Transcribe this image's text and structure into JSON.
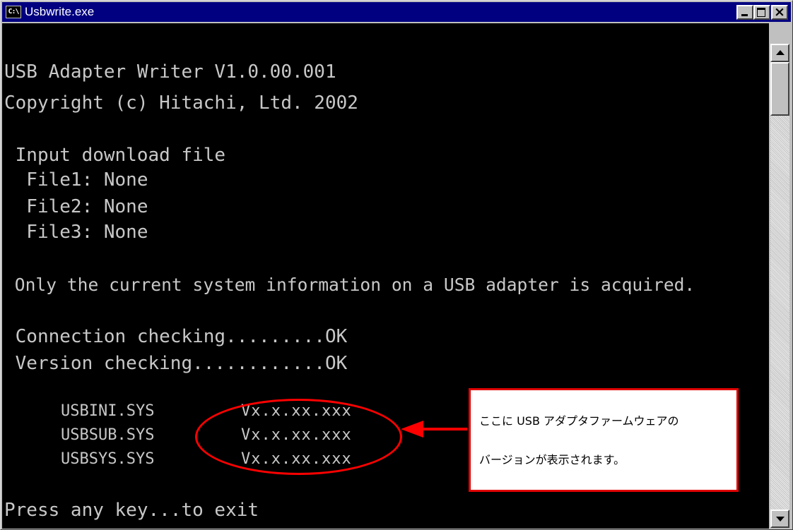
{
  "window": {
    "title": "Usbwrite.exe",
    "icon_name": "console-app-icon",
    "icon_text": "C:\\",
    "controls": {
      "minimize": "minimize-icon",
      "maximize": "maximize-icon",
      "close": "×"
    }
  },
  "console": {
    "lines": [
      "USB Adapter Writer V1.0.00.001",
      "Copyright (c) Hitachi, Ltd. 2002",
      " Input download file",
      "  File1: None",
      "  File2: None",
      "  File3: None",
      " Only the current system information on a USB adapter is acquired.",
      " Connection checking.........OK",
      " Version checking............OK",
      "Press any key...to exit"
    ],
    "versions": [
      {
        "file": "USBINI.SYS",
        "version": "Vx.x.xx.xxx"
      },
      {
        "file": "USBSUB.SYS",
        "version": "Vx.x.xx.xxx"
      },
      {
        "file": "USBSYS.SYS",
        "version": "Vx.x.xx.xxx"
      }
    ],
    "text_color": "#c8c8c8",
    "background": "#000000"
  },
  "annotation": {
    "line1": "ここに USB アダプタファームウェアの",
    "line2": "バージョンが表示されます。",
    "color": "#ff0000"
  },
  "scrollbar": {
    "up": "scroll-up-arrow-icon",
    "down": "scroll-down-arrow-icon"
  }
}
